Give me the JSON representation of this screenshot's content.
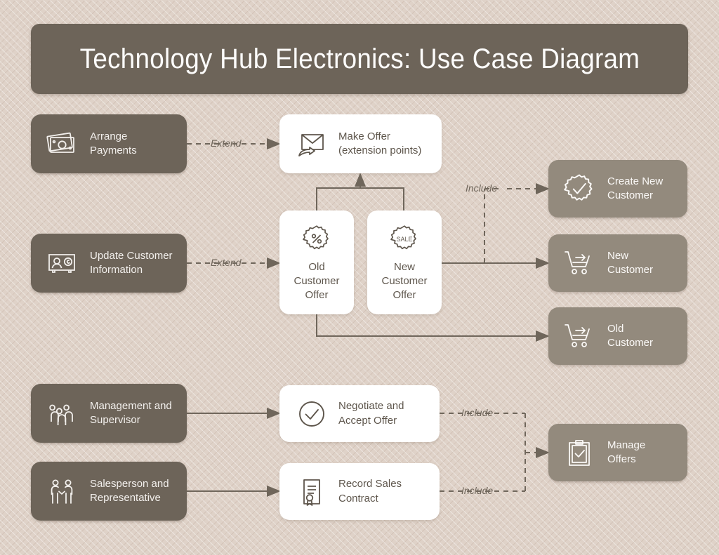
{
  "title": "Technology Hub Electronics: Use Case Diagram",
  "actors": [
    {
      "id": "arrange-payments",
      "label": "Arrange\nPayments",
      "icon": "banknotes-icon"
    },
    {
      "id": "update-customer",
      "label": "Update Customer\nInformation",
      "icon": "contact-card-icon"
    },
    {
      "id": "management",
      "label": "Management and\nSupervisor",
      "icon": "people-group-icon"
    },
    {
      "id": "salesperson",
      "label": "Salesperson and\nRepresentative",
      "icon": "handshake-people-icon"
    }
  ],
  "usecases": [
    {
      "id": "make-offer",
      "label": "Make Offer\n(extension points)",
      "icon": "envelope-arrow-icon"
    },
    {
      "id": "old-customer-offer",
      "label": "Old\nCustomer\nOffer",
      "icon": "percent-badge-icon"
    },
    {
      "id": "new-customer-offer",
      "label": "New\nCustomer\nOffer",
      "icon": "sale-badge-icon"
    },
    {
      "id": "negotiate-offer",
      "label": "Negotiate and\nAccept Offer",
      "icon": "check-circle-icon"
    },
    {
      "id": "record-contract",
      "label": "Record Sales\nContract",
      "icon": "certificate-icon"
    }
  ],
  "results": [
    {
      "id": "create-new-customer",
      "label": "Create New\nCustomer",
      "icon": "check-badge-icon"
    },
    {
      "id": "new-customer",
      "label": "New\nCustomer",
      "icon": "cart-arrow-icon"
    },
    {
      "id": "old-customer",
      "label": "Old\nCustomer",
      "icon": "cart-arrow-icon"
    },
    {
      "id": "manage-offers",
      "label": "Manage\nOffers",
      "icon": "clipboard-check-icon"
    }
  ],
  "edge_labels": {
    "extend_top": "Extend",
    "extend_mid": "Extend",
    "include_create": "Include",
    "include_negotiate": "Include",
    "include_record": "Include"
  },
  "colors": {
    "background": "#dfd2c8",
    "actor": "#6d6459",
    "result": "#938a7d",
    "usecase": "#ffffff",
    "line": "#6f665b",
    "title_text": "#fdfcfb",
    "usecase_text": "#5e564c"
  },
  "diagram_type": "uml-use-case-diagram"
}
